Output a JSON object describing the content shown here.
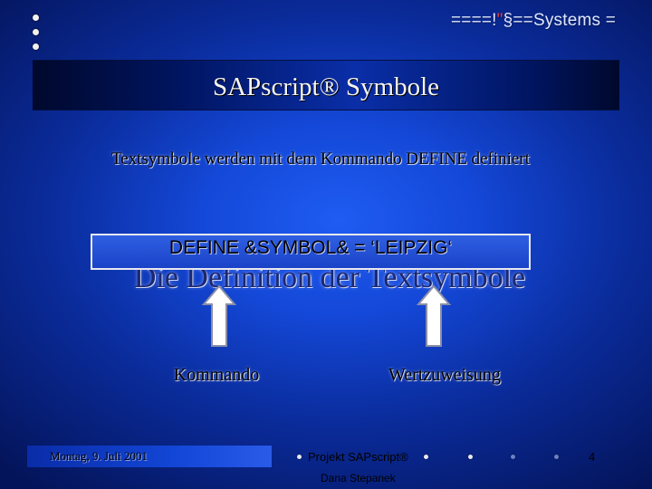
{
  "header": {
    "brand_prefix": "====!",
    "brand_accent": "\"",
    "brand_suffix": "§==Systems ="
  },
  "slide": {
    "title": "SAPscript® Symbole",
    "subtitle": "Textsymbole werden mit dem Kommando DEFINE definiert",
    "heading": "Die Definition der Textsymbole",
    "define_statement": "DEFINE &SYMBOL& = ‘LEIPZIG‘",
    "label_command": "Kommando",
    "label_assignment": "Wertzuweisung"
  },
  "footer": {
    "date": "Montag, 9. Juli 2001",
    "project": "Projekt SAPscript®",
    "author": "Dana Stepanek",
    "page_number": "4"
  },
  "colors": {
    "background": "#1448d8",
    "title_band": "#001561",
    "heading": "#1b2870",
    "accent": "#e04040"
  }
}
